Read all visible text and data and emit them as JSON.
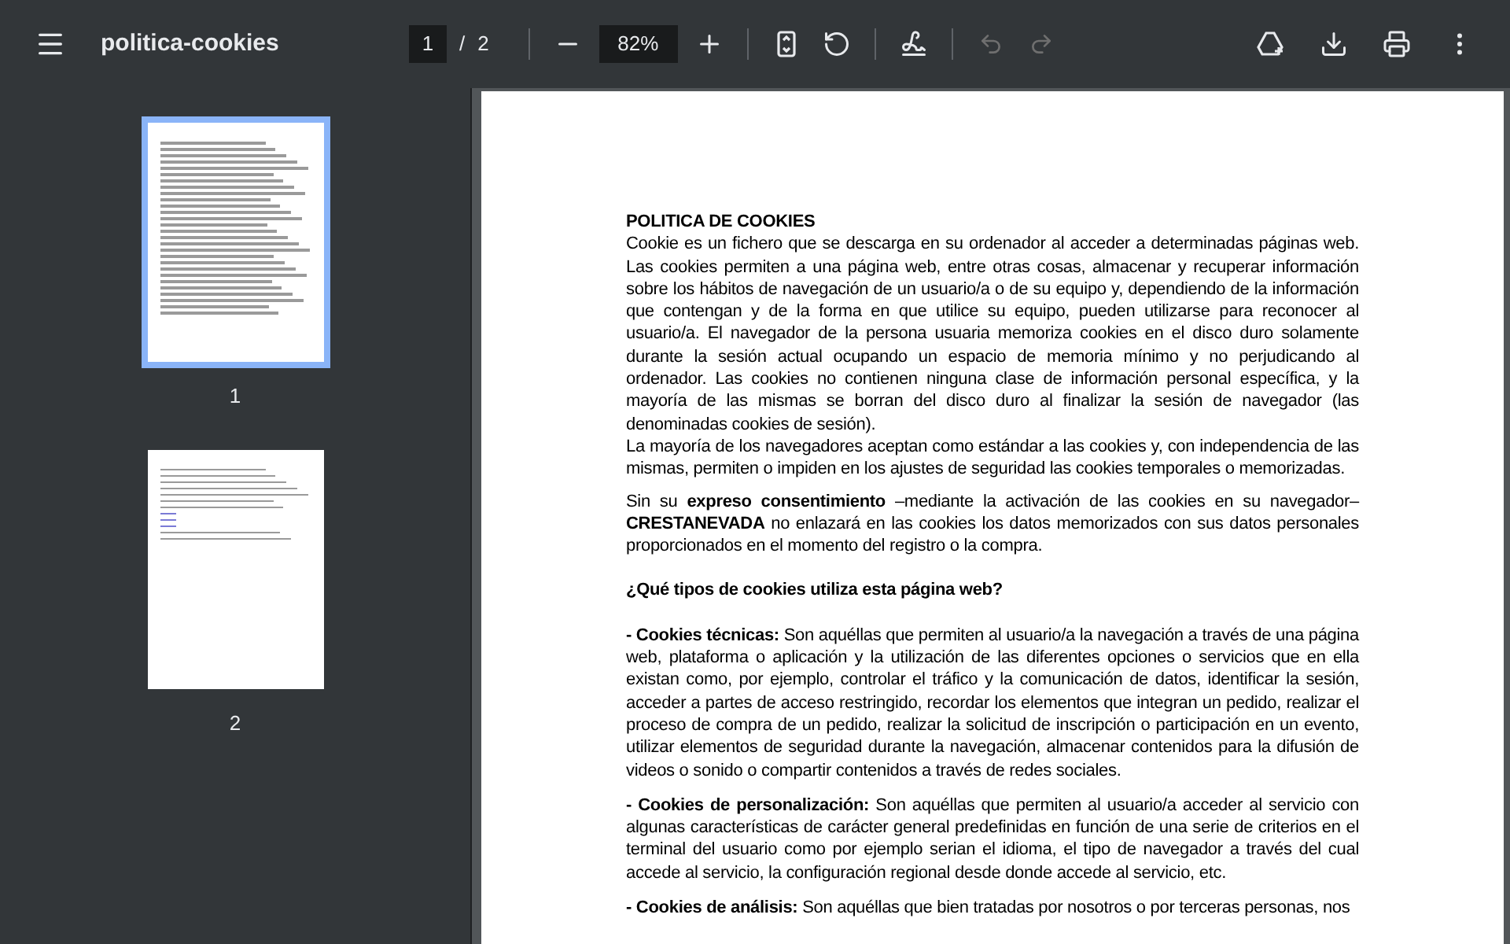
{
  "toolbar": {
    "title": "politica-cookies",
    "page_input": "1",
    "page_separator": "/",
    "page_count": "2",
    "zoom": "82%",
    "undo_disabled": true,
    "redo_disabled": true
  },
  "thumbnails": [
    {
      "label": "1",
      "selected": true
    },
    {
      "label": "2",
      "selected": false
    }
  ],
  "document": {
    "blocks": [
      {
        "kind": "heading",
        "text": "POLITICA DE COOKIES"
      },
      {
        "kind": "para",
        "text": "Cookie es un fichero que se descarga en su ordenador al acceder a determinadas páginas web. Las cookies permiten a una página web, entre otras cosas, almacenar y recuperar información sobre los hábitos de navegación de un usuario/a o de su equipo y, dependiendo de la información que contengan y de la forma en que utilice su equipo, pueden utilizarse para reconocer al usuario/a. El navegador de la persona usuaria memoriza cookies en el disco duro solamente durante la sesión actual ocupando un espacio de memoria mínimo y no perjudicando al ordenador. Las cookies no contienen ninguna clase de información personal específica, y la mayoría de las mismas se borran del disco duro al finalizar la sesión de navegador (las denominadas cookies de sesión)."
      },
      {
        "kind": "para",
        "text": "La mayoría de los navegadores aceptan como estándar a las cookies y, con independencia de las mismas, permiten o impiden en los ajustes de seguridad las cookies temporales o memorizadas."
      },
      {
        "kind": "para_gap",
        "text": "Sin su **expreso consentimiento** –mediante la activación de las cookies en su navegador– **CRESTANEVADA** no enlazará en las cookies los datos memorizados con sus datos personales proporcionados en el momento del registro o la compra."
      },
      {
        "kind": "heading_gap",
        "text": "¿Qué tipos de cookies utiliza esta página web?"
      },
      {
        "kind": "para_gap",
        "text": "**- Cookies técnicas:** Son aquéllas que permiten al usuario/a la navegación a través de una página web, plataforma o aplicación y la utilización de las diferentes opciones o servicios que en ella existan como, por ejemplo, controlar el tráfico y la comunicación de datos, identificar la sesión, acceder a partes de acceso restringido, recordar los elementos que integran un pedido, realizar el proceso de compra de un pedido, realizar la solicitud de inscripción o participación en un evento, utilizar elementos de seguridad durante la navegación, almacenar contenidos para la difusión de videos o sonido o compartir contenidos a través de redes sociales."
      },
      {
        "kind": "para_gap",
        "text": "**- Cookies de personalización:** Son aquéllas que permiten al usuario/a acceder al servicio con algunas características de carácter general predefinidas en función de una serie de criterios en el terminal del usuario como por ejemplo serian el idioma, el tipo de navegador a través del cual accede al servicio, la configuración regional desde donde accede al servicio, etc."
      },
      {
        "kind": "para_gap",
        "text": "**- Cookies de análisis:** Son aquéllas que bien tratadas por nosotros o por terceras personas, nos"
      }
    ]
  }
}
